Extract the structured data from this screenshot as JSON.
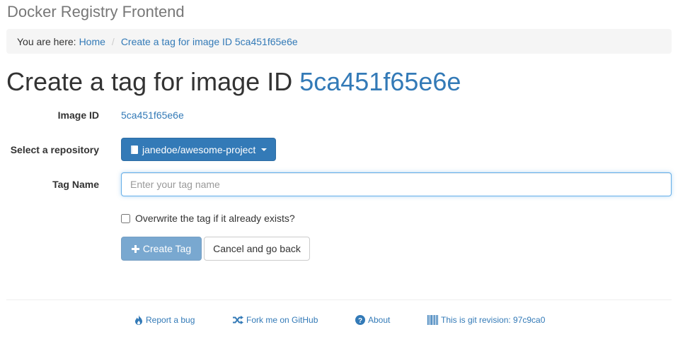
{
  "app": {
    "brand": "Docker Registry Frontend"
  },
  "breadcrumb": {
    "prefix": "You are here:",
    "items": [
      {
        "label": "Home"
      },
      {
        "label": "Create a tag for image ID 5ca451f65e6e"
      }
    ]
  },
  "page": {
    "title_prefix": "Create a tag for image ID",
    "title_id": "5ca451f65e6e"
  },
  "form": {
    "image_id_label": "Image ID",
    "image_id_value": "5ca451f65e6e",
    "repo_label": "Select a repository",
    "repo_selected": "janedoe/awesome-project",
    "tag_name_label": "Tag Name",
    "tag_name_placeholder": "Enter your tag name",
    "tag_name_value": "",
    "overwrite_label": "Overwrite the tag if it already exists?",
    "overwrite_checked": false,
    "create_button": "Create Tag",
    "cancel_button": "Cancel and go back"
  },
  "footer": {
    "links": [
      {
        "label": "Report a bug",
        "icon": "fire-icon"
      },
      {
        "label": "Fork me on GitHub",
        "icon": "random-icon"
      },
      {
        "label": "About",
        "icon": "question-sign-icon"
      },
      {
        "label": "This is git revision: 97c9ca0",
        "icon": "barcode-icon"
      }
    ]
  },
  "colors": {
    "link": "#337ab7",
    "primary": "#337ab7",
    "muted": "#777777"
  }
}
